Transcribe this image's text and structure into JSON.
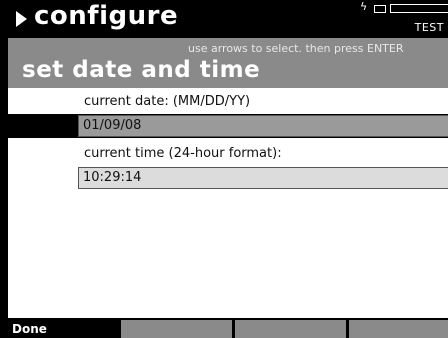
{
  "titlebar": {
    "title": "configure",
    "status_icons": [
      "charging-bolt-icon",
      "plug-icon",
      "battery-icon"
    ],
    "mode": "TEST"
  },
  "header": {
    "hint": "use arrows to select. then press ENTER",
    "heading": "set date and time"
  },
  "form": {
    "date_label": "current date: (MM/DD/YY)",
    "date_value": "01/09/08",
    "time_label": "current time (24-hour format):",
    "time_value": "10:29:14"
  },
  "softkeys": {
    "done_label": "Done",
    "key2_label": "",
    "key3_label": "",
    "key4_label": ""
  },
  "colors": {
    "titlebar": "#000000",
    "header": "#8a8a8a",
    "selected_row": "#000000",
    "selected_field": "#9a9a9a",
    "field": "#dcdcdc"
  }
}
